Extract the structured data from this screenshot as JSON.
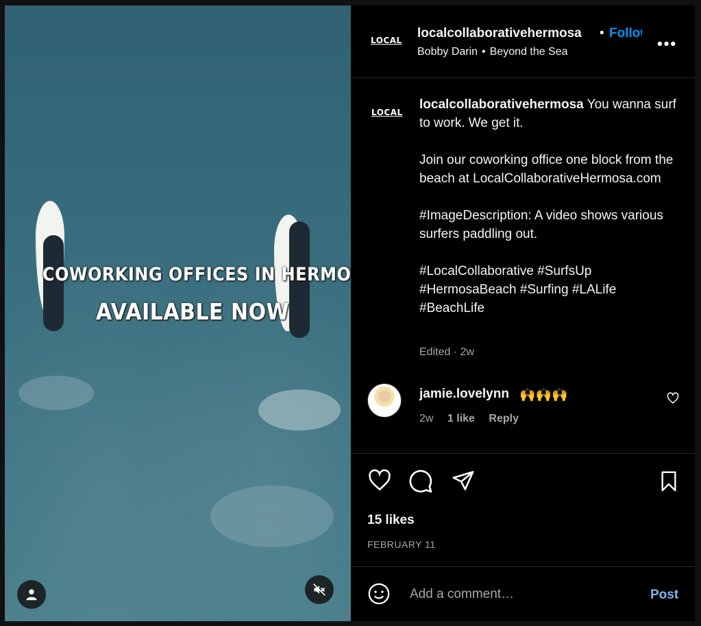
{
  "media": {
    "overlay_line1": "COWORKING OFFICES IN HERMOSA",
    "overlay_line2": "AVAILABLE NOW",
    "user_icon": "user-icon",
    "mute_icon": "muted-speaker-icon"
  },
  "header": {
    "logo_text": "LOCAL",
    "username": "localcollaborativehermosa",
    "separator": "•",
    "follow_label": "Follow",
    "audio_artist": "Bobby Darin",
    "audio_sep": "•",
    "audio_track": "Beyond the Sea",
    "more_label": "•••"
  },
  "caption": {
    "logo_text": "LOCAL",
    "username": "localcollaborativehermosa",
    "text1": " You wanna surf to work. We get it.",
    "text2": "Join our coworking office one block from the beach at LocalCollaborativeHermosa.com",
    "text3": "#ImageDescription: A video shows various surfers paddling out.",
    "text4": "#LocalCollaborative #SurfsUp #HermosaBeach #Surfing #LALife #BeachLife",
    "meta": "Edited · 2w"
  },
  "comment": {
    "username": "jamie.lovelynn",
    "emojis": "🙌🙌🙌",
    "time": "2w",
    "likes": "1 like",
    "reply": "Reply"
  },
  "actions": {
    "likes": "15 likes",
    "date": "FEBRUARY 11"
  },
  "add_comment": {
    "placeholder": "Add a comment…",
    "post_label": "Post"
  },
  "colors": {
    "follow": "#0095f6",
    "post": "#7fb6ef",
    "muted_text": "#a8a8a8",
    "background": "#000000"
  }
}
